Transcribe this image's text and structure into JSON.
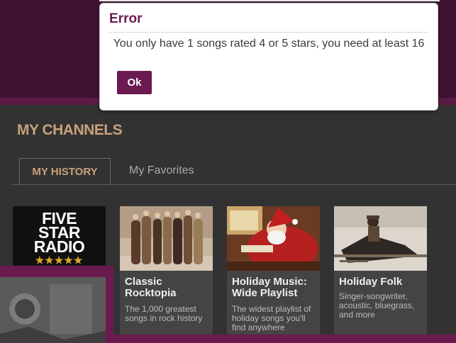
{
  "dialog": {
    "title": "Error",
    "message": "You only have 1 songs rated 4 or 5 stars, you need at least 16",
    "ok_label": "Ok"
  },
  "section": {
    "title": "MY CHANNELS"
  },
  "tabs": [
    {
      "label": "MY HISTORY",
      "active": true
    },
    {
      "label": "My Favorites",
      "active": false
    }
  ],
  "logo_card": {
    "line1": "FIVE",
    "line2": "STAR",
    "line3": "RADIO",
    "stars": "★★★★★"
  },
  "cards": [
    {
      "title": "Classic Rocktopia",
      "description": "The 1,000 greatest songs in rock history",
      "icon": "band-photo"
    },
    {
      "title": "Holiday Music: Wide Playlist",
      "description": "The widest playlist of holiday songs you'll find anywhere",
      "icon": "santa-photo"
    },
    {
      "title": "Holiday Folk",
      "description": "Singer-songwriter, acoustic, bluegrass, and more",
      "icon": "snow-sled-photo"
    }
  ],
  "colors": {
    "brand_purple": "#6b1a4f",
    "header_purple": "#3f1231",
    "accent_tan": "#c8a27a",
    "background": "#333232"
  }
}
